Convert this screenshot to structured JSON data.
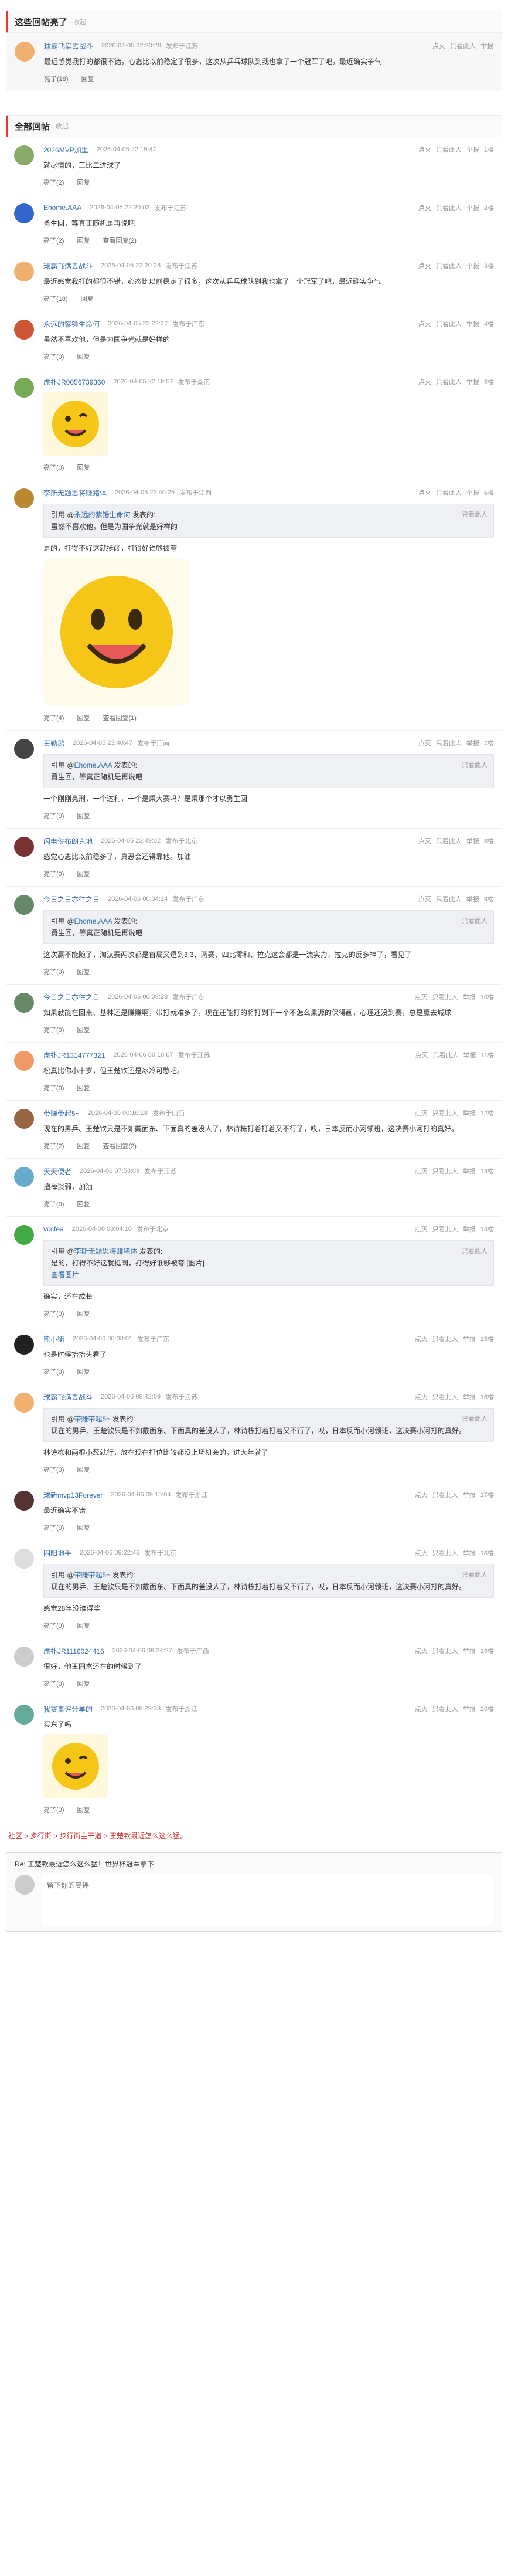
{
  "hot_section": {
    "title": "这些回帖亮了",
    "collapse": "收起"
  },
  "all_section": {
    "title": "全部回帖",
    "collapse": "收起"
  },
  "actions": {
    "like": "亮了",
    "reply": "回复",
    "view_replies": "查看回复",
    "right_report": "举报",
    "right_light": "点灭",
    "right_only": "只看此人"
  },
  "hot_posts": [
    {
      "name": "球霸飞满去战斗",
      "time": "2026-04-05 22:20:28",
      "from": "发布于江苏",
      "text": "最近感觉我打的都很不错，心态比以前稳定了很多，这次从乒乓球队到我也拿了一个冠军了吧，最近确实争气",
      "like": "亮了(18)",
      "avatar": "#f0b070"
    }
  ],
  "posts": [
    {
      "name": "2026MVP加里",
      "time": "2026-04-05 22:19:47",
      "from": "",
      "floor": "1楼",
      "text": "就尽情的，三比二进球了",
      "like": "亮了(2)",
      "avatar": "#8a6",
      "replies": ""
    },
    {
      "name": "Ehome.AAA",
      "time": "2026-04-05 22:20:03",
      "from": "发布于江苏",
      "floor": "2楼",
      "text": "勇生回，等真正随机是再说吧",
      "like": "亮了(2)",
      "avatar": "#36c",
      "replies": "查看回复(2)"
    },
    {
      "name": "球霸飞满去战斗",
      "time": "2026-04-05 22:20:28",
      "from": "发布于江苏",
      "floor": "3楼",
      "text": "最近感觉我打的都很不错，心态比以前稳定了很多，这次从乒乓球队到我也拿了一个冠军了吧，最近确实争气",
      "like": "亮了(18)",
      "avatar": "#f0b070",
      "replies": ""
    },
    {
      "name": "永远的紫锤生命何",
      "time": "2026-04-05 22:22:27",
      "from": "发布于广东",
      "floor": "4楼",
      "text": "虽然不喜欢他，但是为国争光就是好样的",
      "like": "亮了(0)",
      "avatar": "#c53",
      "replies": ""
    },
    {
      "name": "虎扑JR0056739360",
      "time": "2026-04-05 22:19:57",
      "from": "发布于湖南",
      "floor": "5楼",
      "text": "",
      "like": "亮了(0)",
      "avatar": "#7a5",
      "replies": "",
      "image": "emoji"
    },
    {
      "name": "李斯无题思将赚猪体",
      "time": "2026-04-05 22:40:25",
      "from": "发布于江西",
      "floor": "6楼",
      "quote_name": "永远的紫锤生命何",
      "quote_text": "虽然不喜欢他，但是为国争光就是好样的",
      "text": "是的，打得不好这就挺阔，打得好谁够被夸",
      "like": "亮了(4)",
      "avatar": "#b83",
      "replies": "查看回复(1)",
      "image": "big"
    },
    {
      "name": "王勤鹅",
      "time": "2026-04-05 23:40:47",
      "from": "发布于河南",
      "floor": "7楼",
      "quote_name": "Ehome.AAA",
      "quote_text": "勇生回，等真正随机是再说吧",
      "text": "一个刚刚亮刑，一个达利，一个是乘大赛吗？是乘那个才以勇生回",
      "like": "亮了(0)",
      "avatar": "#444",
      "replies": ""
    },
    {
      "name": "闪电侠布朗克地",
      "time": "2026-04-05 23:49:02",
      "from": "发布于北京",
      "floor": "8楼",
      "text": "感觉心态比以前稳多了，真恶会还得靠他。加油",
      "like": "亮了(0)",
      "avatar": "#733",
      "replies": ""
    },
    {
      "name": "今日之日亦往之日",
      "time": "2026-04-06 00:04:24",
      "from": "发布于广东",
      "floor": "9楼",
      "quote_name": "Ehome.AAA",
      "quote_text": "勇生回，等真正随机是再说吧",
      "text": "这次赢不能随了，淘汰赛两次都是首局又逗到3:3、两赛、四比零和、拉克这会都是一流实力，拉克的反多神了，看见了",
      "like": "亮了(0)",
      "avatar": "#686",
      "replies": ""
    },
    {
      "name": "今日之日亦往之日",
      "time": "2026-04-06 00:09:23",
      "from": "发布于广东",
      "floor": "10楼",
      "text": "如果就能在回来、基林还是赚赚啊，带打就难多了，现在还能打的将打到下一个不怎么果源的保得画，心理还没到赛，总是赢去城球",
      "like": "亮了(0)",
      "avatar": "#686",
      "replies": ""
    },
    {
      "name": "虎扑JR1314777321",
      "time": "2026-04-06 00:10:07",
      "from": "发布于江苏",
      "floor": "11楼",
      "text": "松真比你小十岁，但王楚钦还是冰冷可憨吧。",
      "like": "亮了(0)",
      "avatar": "#e96",
      "replies": ""
    },
    {
      "name": "带赚带起5~",
      "time": "2026-04-06 00:16:18",
      "from": "发布于山西",
      "floor": "12楼",
      "text": "现在的男乒、王楚钦只是不如戴面东、下面真的差没人了，林诗栋打着打着又不行了，哎，日本反而小河领班，这决赛小河打的真好。",
      "like": "亮了(2)",
      "avatar": "#964",
      "replies": "查看回复(2)"
    },
    {
      "name": "天天便者",
      "time": "2026-04-06 07:53:09",
      "from": "发布于江苏",
      "floor": "13楼",
      "text": "擅禅淡弱，加油",
      "like": "亮了(0)",
      "avatar": "#6ac",
      "replies": ""
    },
    {
      "name": "vccfea",
      "time": "2026-04-06 08:04:16",
      "from": "发布于北京",
      "floor": "14楼",
      "quote_name": "李斯无题思将赚猪体",
      "quote_text": "是的，打得不好这就挺阔，打得好谁够被夸 [图片]",
      "quote_link": "查看图片",
      "text": "确实，还在成长",
      "like": "亮了(0)",
      "avatar": "#4a4",
      "replies": ""
    },
    {
      "name": "熊小衡",
      "time": "2026-04-06 08:08:01",
      "from": "发布于广东",
      "floor": "15楼",
      "text": "也是时候抬抬头看了",
      "like": "亮了(0)",
      "avatar": "#222",
      "replies": ""
    },
    {
      "name": "球霸飞满去战斗",
      "time": "2026-04-06 08:42:09",
      "from": "发布于江苏",
      "floor": "16楼",
      "quote_name": "带赚带起5~",
      "quote_text": "现在的男乒、王楚钦只是不如戴面东、下面真的差没人了，林诗栋打着打着又不行了，哎，日本反而小河领班，这决赛小河打的真好。",
      "text": "林诗栋和两根小葱就行，放在现在打位比较都没上场机会的，进大年就了",
      "like": "亮了(0)",
      "avatar": "#f0b070",
      "replies": ""
    },
    {
      "name": "球新mvp13Forever",
      "time": "2026-04-06 09:15:04",
      "from": "发布于浙江",
      "floor": "17楼",
      "text": "最近确实不错",
      "like": "亮了(0)",
      "avatar": "#533",
      "replies": ""
    },
    {
      "name": "固阳地手",
      "time": "2026-04-06 09:22:46",
      "from": "发布于北京",
      "floor": "18楼",
      "quote_name": "带赚带起5~",
      "quote_text": "现在的男乒、王楚钦只是不如戴面东、下面真的差没人了，林诗栋打着打着又不行了，哎，日本反而小河领班，这决赛小河打的真好。",
      "text": "感觉28年没谁得奖",
      "like": "亮了(0)",
      "avatar": "#ddd",
      "replies": ""
    },
    {
      "name": "虎扑JR1116024416",
      "time": "2026-04-06 09:24:27",
      "from": "发布于广西",
      "floor": "19楼",
      "text": "很好，他王同杰还在的时候到了",
      "like": "亮了(0)",
      "avatar": "#ccc",
      "replies": ""
    },
    {
      "name": "我赛事评分单的",
      "time": "2026-04-06 09:29:33",
      "from": "发布于浙江",
      "floor": "20楼",
      "text": "买东了吗",
      "like": "亮了(0)",
      "avatar": "#6a9",
      "replies": "",
      "image": "emoji"
    }
  ],
  "breadcrumb": {
    "a": "社区",
    "b": "步行街",
    "c": "步行街主干道",
    "d": "王楚钦最近怎么这么猛。"
  },
  "reply": {
    "title": "Re: 王楚钦最近怎么这么猛！世界杯冠军拿下",
    "placeholder": "留下你的高评"
  }
}
